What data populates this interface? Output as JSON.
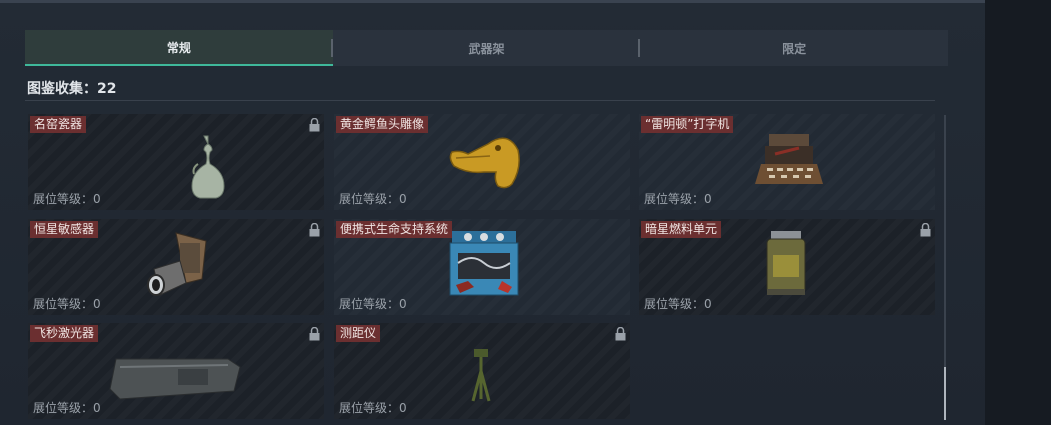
{
  "tabs": [
    "常规",
    "武器架",
    "限定"
  ],
  "collection": {
    "label": "图鉴收集：22"
  },
  "items": [
    {
      "name": "名窑瓷器",
      "level": "展位等级：0"
    },
    {
      "name": "黄金鳄鱼头雕像",
      "level": "展位等级：0"
    },
    {
      "name": "“雷明顿”打字机",
      "level": "展位等级：0"
    },
    {
      "name": "恒星敏感器",
      "level": "展位等级：0"
    },
    {
      "name": "便携式生命支持系统",
      "level": "展位等级：0"
    },
    {
      "name": "暗星燃料单元",
      "level": "展位等级：0"
    },
    {
      "name": "飞秒激光器",
      "level": "展位等级：0"
    },
    {
      "name": "测距仪",
      "level": "展位等级：0"
    }
  ],
  "colors": {
    "accent": "#3fb89a",
    "name_tag": "#6b2f30"
  }
}
